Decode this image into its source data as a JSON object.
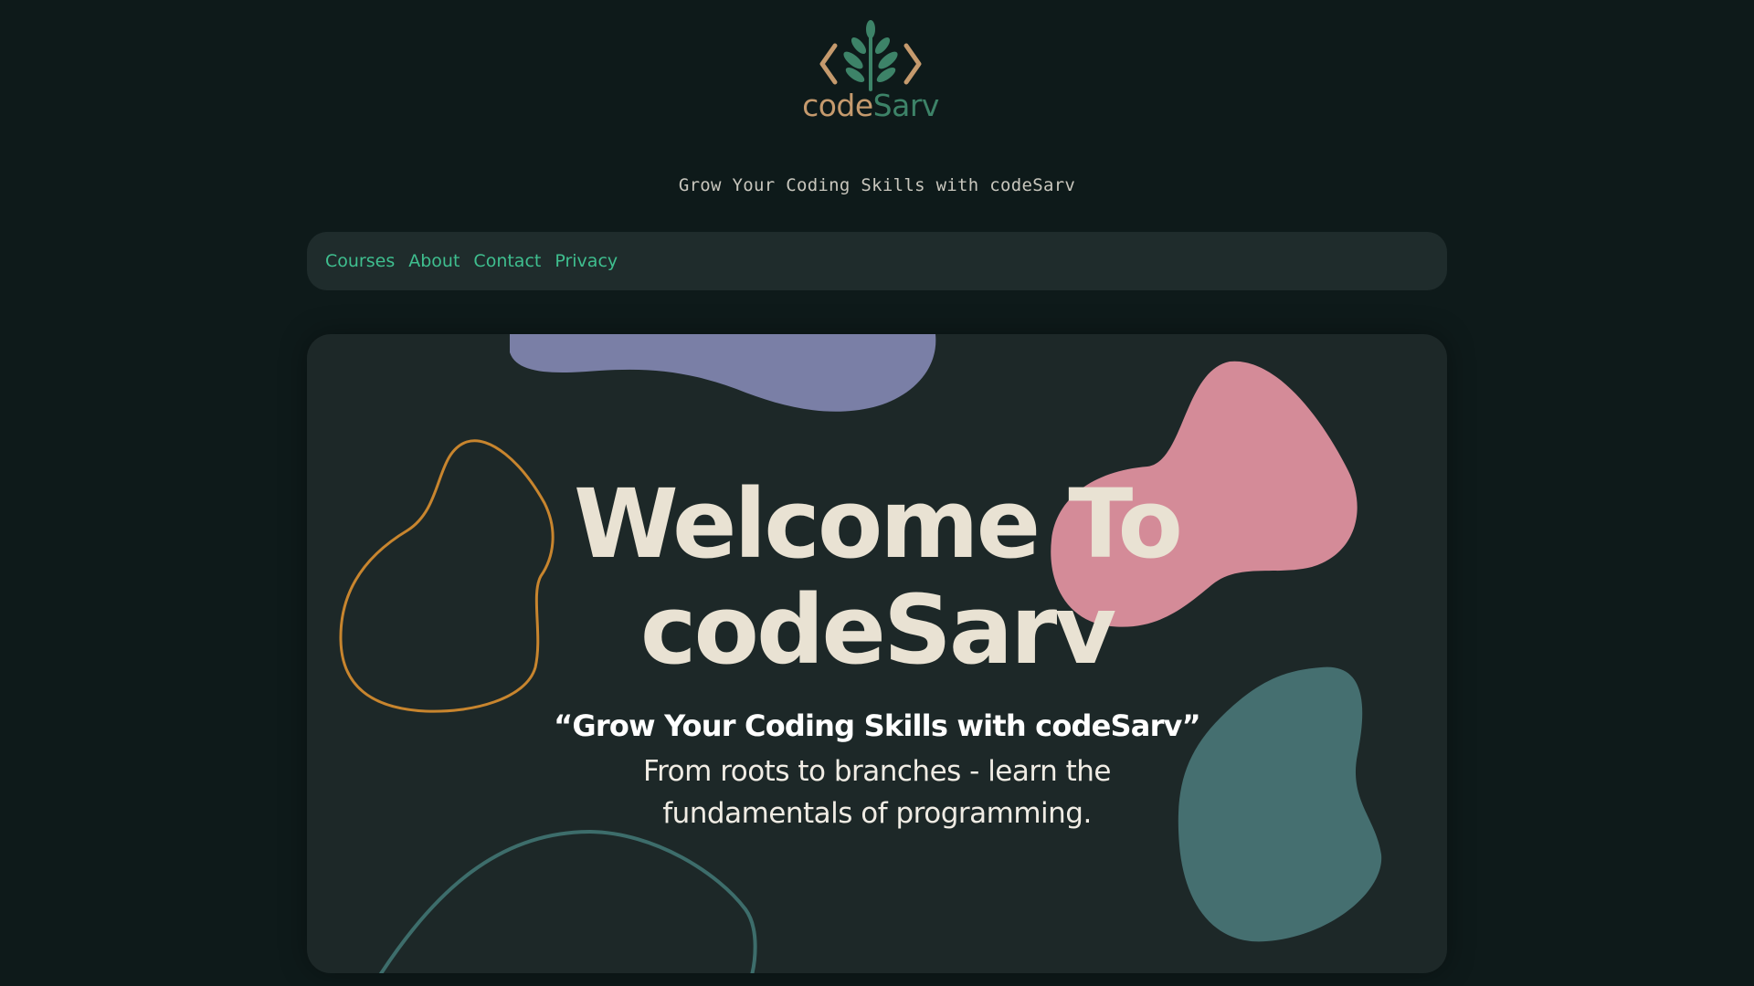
{
  "brand": {
    "name_part1": "code",
    "name_part2": "Sarv",
    "colors": {
      "tan": "#c59a6d",
      "green": "#3d8368"
    },
    "icon": "tree-code-brackets-icon"
  },
  "tagline": "Grow Your Coding Skills with codeSarv",
  "nav": {
    "items": [
      {
        "label": "Courses"
      },
      {
        "label": "About"
      },
      {
        "label": "Contact"
      },
      {
        "label": "Privacy"
      }
    ],
    "link_color": "#3fbf8f"
  },
  "hero": {
    "title_line1": "Welcome To",
    "title_line2": "codeSarv",
    "quote": "“Grow Your Coding Skills with codeSarv”",
    "subtitle": "From roots to branches - learn the fundamentals of programming.",
    "blob_colors": {
      "lavender": "#7a7fa6",
      "pink": "#d48b98",
      "teal": "#456f70",
      "orange_outline": "#c8852e",
      "teal_outline": "#3d6d6b"
    }
  }
}
